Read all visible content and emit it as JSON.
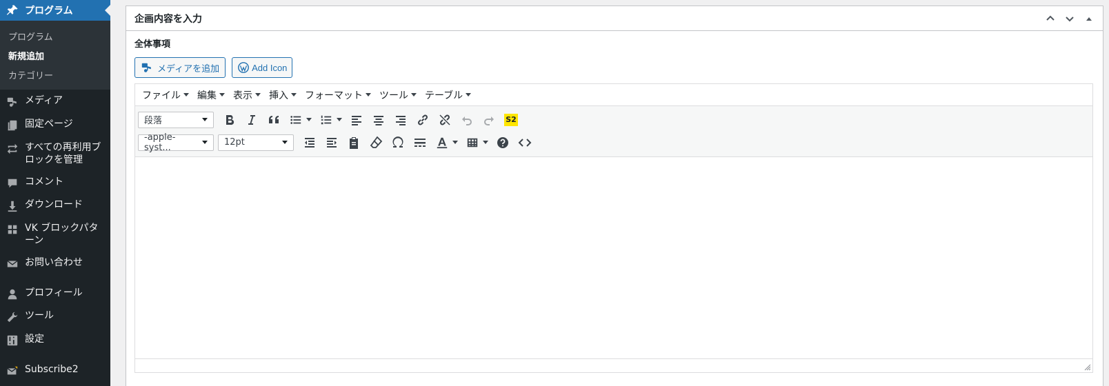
{
  "sidebar": {
    "active": {
      "label": "プログラム",
      "icon": "pin-icon"
    },
    "submenu": [
      {
        "label": "プログラム",
        "current": false
      },
      {
        "label": "新規追加",
        "current": true
      },
      {
        "label": "カテゴリー",
        "current": false
      }
    ],
    "items": [
      {
        "label": "メディア",
        "icon": "media-icon"
      },
      {
        "label": "固定ページ",
        "icon": "page-icon"
      },
      {
        "label": "すべての再利用ブロックを管理",
        "icon": "reuse-icon"
      },
      {
        "label": "コメント",
        "icon": "comment-icon"
      },
      {
        "label": "ダウンロード",
        "icon": "download-icon"
      },
      {
        "label": "VK ブロックパターン",
        "icon": "grid-icon"
      },
      {
        "label": "お問い合わせ",
        "icon": "mail-icon"
      },
      {
        "label": "プロフィール",
        "icon": "user-icon"
      },
      {
        "label": "ツール",
        "icon": "wrench-icon"
      },
      {
        "label": "設定",
        "icon": "settings-icon"
      },
      {
        "label": "Subscribe2",
        "icon": "subscribe-icon"
      }
    ]
  },
  "postbox": {
    "title": "企画内容を入力",
    "section_label": "全体事項",
    "add_media_label": "メディアを追加",
    "add_icon_label": "Add Icon"
  },
  "editor": {
    "menus": [
      "ファイル",
      "編集",
      "表示",
      "挿入",
      "フォーマット",
      "ツール",
      "テーブル"
    ],
    "format_select": "段落",
    "font_family_select": "-apple-syst...",
    "font_size_select": "12pt",
    "s2_badge": "S2"
  },
  "colors": {
    "sidebar_bg": "#1d2327",
    "accent": "#2271b1"
  }
}
